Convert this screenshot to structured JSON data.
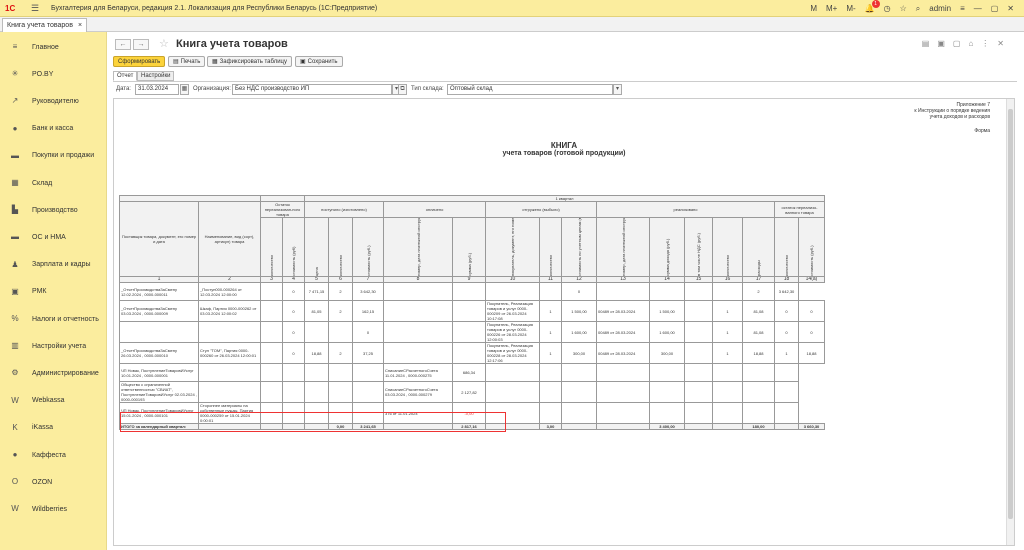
{
  "app": {
    "logo": "1С",
    "title": "Бухгалтерия для Беларуси, редакция 2.1. Локализация для Республики Беларусь   (1С:Предприятие)",
    "toolbar_items": [
      "M",
      "M+",
      "M-"
    ],
    "notifications_count": "1",
    "user": "admin"
  },
  "doc_tab": {
    "label": "Книга учета товаров",
    "close": "×"
  },
  "sidebar": {
    "items": [
      {
        "icon": "menu-icon",
        "glyph": "≡",
        "label": "Главное"
      },
      {
        "icon": "po-by-icon",
        "glyph": "✳",
        "label": "PO.BY"
      },
      {
        "icon": "chart-icon",
        "glyph": "↗",
        "label": "Руководителю"
      },
      {
        "icon": "bank-icon",
        "glyph": "●",
        "label": "Банк и касса"
      },
      {
        "icon": "cart-icon",
        "glyph": "▬",
        "label": "Покупки и продажи"
      },
      {
        "icon": "warehouse-icon",
        "glyph": "▦",
        "label": "Склад"
      },
      {
        "icon": "production-icon",
        "glyph": "▙",
        "label": "Производство"
      },
      {
        "icon": "assets-icon",
        "glyph": "▬",
        "label": "ОС и НМА"
      },
      {
        "icon": "salary-icon",
        "glyph": "♟",
        "label": "Зарплата и кадры"
      },
      {
        "icon": "rmk-icon",
        "glyph": "▣",
        "label": "РМК"
      },
      {
        "icon": "taxes-icon",
        "glyph": "%",
        "label": "Налоги и отчетность"
      },
      {
        "icon": "settings-book-icon",
        "glyph": "▥",
        "label": "Настройки учета"
      },
      {
        "icon": "gear-icon",
        "glyph": "⚙",
        "label": "Администрирование"
      },
      {
        "icon": "webkassa-icon",
        "glyph": "W",
        "label": "Webkassa"
      },
      {
        "icon": "ikassa-icon",
        "glyph": "K",
        "label": "iKassa"
      },
      {
        "icon": "kaffesta-icon",
        "glyph": "●",
        "label": "Каффеста"
      },
      {
        "icon": "ozon-icon",
        "glyph": "O",
        "label": "OZON"
      },
      {
        "icon": "wildberries-icon",
        "glyph": "W",
        "label": "Wildberries"
      }
    ]
  },
  "header": {
    "title": "Книга учета товаров",
    "back": "←",
    "forward": "→",
    "star": "☆"
  },
  "buttons": {
    "generate": "Сформировать",
    "print": "Печать",
    "pin": "Зафиксировать таблицу",
    "save": "Сохранить"
  },
  "form_tabs": [
    "Отчет",
    "Настройки"
  ],
  "filters": {
    "date_label": "Дата:",
    "date_value": "31.03.2024",
    "org_label": "Организация:",
    "org_value": "Без НДС производство ИП",
    "stock_label": "Тип склада:",
    "stock_value": "Оптовый склад"
  },
  "report": {
    "appendix": [
      "Приложение 7",
      "к Инструкции о порядке ведения",
      "учета доходов и расходов"
    ],
    "form": "Форма",
    "title1": "КНИГА",
    "title2": "учета товаров (готовой продукции)",
    "quarter": "1 квартал",
    "h_supplier": "Поставщик товара, документ, его номер и дата",
    "h_name": "Наименование, вид (сорт), артикул) товара",
    "h_balance": "Остаток нереализован-ного товара",
    "h_received": "поступило (изготовлено)",
    "h_paid": "оплачено",
    "h_shipped": "отгружено (выбыло)",
    "h_sold": "реализовано",
    "h_rest": "остаток нереализо-ванного товара",
    "v": {
      "qty": "количество",
      "cost": "стоимость (руб)",
      "price": "цена",
      "cost2": "стоимость (руб.)",
      "paydoc": "номер, дата платежной инструкции",
      "paysum": "сумма (руб.)",
      "buyer": "покупатель, документ, его номер и дата",
      "shipcost": "стоимость по учетным ценам (выбытия – по ценам приобретения) (руб)",
      "paydoc2": "номер, дата платежной инструкции",
      "income": "сумма дохода (руб.)",
      "vat": "в том числе НДС (руб.)",
      "expenses": "расходы"
    },
    "col_numbers": [
      "1",
      "2",
      "3",
      "4",
      "5",
      "6",
      "7",
      "8",
      "9",
      "10",
      "11",
      "12",
      "13",
      "14",
      "15",
      "16",
      "17",
      "18"
    ],
    "rows": [
      [
        "_ОтчетПроизводстваЗаСмену 12.02.2024 , 0000-000011",
        "_Поступ000-000264 от 12.03.2024 12:00:00",
        "",
        "0",
        "7 471,15",
        "2",
        "3 642,30",
        "",
        "",
        "",
        "",
        "0",
        "",
        "",
        "",
        "",
        "2",
        "3 642,30"
      ],
      [
        "_ОтчетПроизводстваЗаСмену 03.03.2024 , 0000-000009",
        "Шкаф, Партия 0000-000262 от 03.03.2024 12:00:02",
        "",
        "0",
        "81,05",
        "2",
        "162,15",
        "",
        "",
        "Покупатель, Реализация товаров и услуг 0000-000209 от 26.03.2024 10:17:08",
        "1",
        "1 500,00",
        "00489 от 28.03.2024",
        "1 500,00",
        "",
        "1",
        "81,08",
        "0",
        "0"
      ],
      [
        "",
        "",
        "",
        "0",
        "",
        "",
        "0",
        "",
        "",
        "Покупатель, Реализация товаров и услуг 0000-000226 от 28.03.2024 12:00:03",
        "1",
        "1 600,00",
        "00489 от 28.03.2024",
        "1 600,00",
        "",
        "1",
        "81,08",
        "0",
        "0"
      ],
      [
        "_ОтчетПроизводстваЗаСмену 26.03.2024 , 0000-000010",
        "Стул \"ТОМ\", Партия 0000-000260 от 26.03.2024 12:00:01",
        "",
        "0",
        "18,88",
        "2",
        "37,25",
        "",
        "",
        "Покупатель, Реализация товаров и услуг 0000-000228 от 28.03.2024 12:17:06",
        "1",
        "300,00",
        "00489 от 28.03.2024",
        "300,00",
        "",
        "1",
        "18,88",
        "1",
        "18,88"
      ],
      [
        "ЧП Новак, ПоступлениеТоваровИУслуг 10.01.2024 , 0000-000001",
        "",
        "",
        "",
        "",
        "",
        "",
        "СписаниеСРасчетногоСчета 11.01.2024 , 0000-000275",
        "686,34",
        "",
        "",
        "",
        "",
        "",
        "",
        "",
        "",
        ""
      ],
      [
        "Общество с ограниченной ответственностью \"СВИАТ\", ПоступлениеТоваровИУслуг 02.03.2024 , 0000-000193",
        "",
        "",
        "",
        "",
        "",
        "",
        "СписаниеСРасчетногоСчета 03.03.2024 , 0000-000279",
        "2 127,82",
        "",
        "",
        "",
        "",
        "",
        "",
        "",
        "",
        ""
      ],
      [
        "ЧП Новак, ПоступлениеТоваровИУслуг 15.01.2024 , 0000-000101",
        "Стороннее материалы на собственные нужды, Партия 0000-000259 от 15.01.2024 0:00:01",
        "",
        "",
        "",
        "",
        "",
        "376 от 11.01.2024",
        "-0,00",
        "",
        "",
        "",
        "",
        "",
        "",
        "",
        "",
        ""
      ]
    ],
    "total": [
      "ИТОГО за календарный квартал:",
      "",
      "",
      "",
      "",
      "0,00",
      "3 241,65",
      "",
      "2 817,16",
      "",
      "3,00",
      "",
      "",
      "3 400,00",
      "",
      "",
      "180,00",
      "",
      "3 660,30"
    ]
  }
}
